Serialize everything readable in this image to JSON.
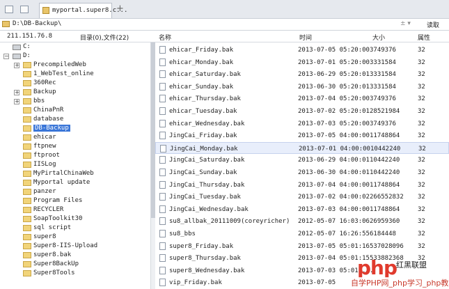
{
  "tabbar": {
    "tab_label": "myportal.super8.c...",
    "new_tab": "+"
  },
  "address": {
    "path": "D:\\DB-Backup\\",
    "arrows": "± ▾",
    "read_button": "读取"
  },
  "header": {
    "ip": "211.151.76.8",
    "summary": "目录(0),文件(22)",
    "col_name": "名称",
    "col_time": "时间",
    "col_size": "大小",
    "col_attr": "属性"
  },
  "tree": {
    "drive_c": "C:",
    "drive_d": "D:",
    "folders": [
      "PrecompiledWeb",
      "1_WebTest_online",
      "360Rec",
      "Backup",
      "bbs",
      "ChinaPnR",
      "database",
      "DB-Backup",
      "ehicar",
      "ftpnew",
      "ftproot",
      "IISLog",
      "MyPirtalChinaWeb",
      "Myportal update",
      "panzer",
      "Program Files",
      "RECYCLER",
      "SoapToolkit30",
      "sql script",
      "super8",
      "Super8-IIS-Upload",
      "super8.bak",
      "Super8BackUp",
      "Super8Tools"
    ]
  },
  "files": [
    {
      "name": "ehicar_Friday.bak",
      "time": "2013-07-05 05:20:00",
      "size": "3749376",
      "attr": "32"
    },
    {
      "name": "ehicar_Monday.bak",
      "time": "2013-07-01 05:20:00",
      "size": "3331584",
      "attr": "32"
    },
    {
      "name": "ehicar_Saturday.bak",
      "time": "2013-06-29 05:20:01",
      "size": "3331584",
      "attr": "32"
    },
    {
      "name": "ehicar_Sunday.bak",
      "time": "2013-06-30 05:20:01",
      "size": "3331584",
      "attr": "32"
    },
    {
      "name": "ehicar_Thursday.bak",
      "time": "2013-07-04 05:20:00",
      "size": "3749376",
      "attr": "32"
    },
    {
      "name": "ehicar_Tuesday.bak",
      "time": "2013-07-02 05:20:01",
      "size": "28521984",
      "attr": "32"
    },
    {
      "name": "ehicar_Wednesday.bak",
      "time": "2013-07-03 05:20:00",
      "size": "3749376",
      "attr": "32"
    },
    {
      "name": "JingCai_Friday.bak",
      "time": "2013-07-05 04:00:00",
      "size": "11748864",
      "attr": "32"
    },
    {
      "name": "JingCai_Monday.bak",
      "time": "2013-07-01 04:00:00",
      "size": "10442240",
      "attr": "32"
    },
    {
      "name": "JingCai_Saturday.bak",
      "time": "2013-06-29 04:00:01",
      "size": "10442240",
      "attr": "32"
    },
    {
      "name": "JingCai_Sunday.bak",
      "time": "2013-06-30 04:00:01",
      "size": "10442240",
      "attr": "32"
    },
    {
      "name": "JingCai_Thursday.bak",
      "time": "2013-07-04 04:00:00",
      "size": "11748864",
      "attr": "32"
    },
    {
      "name": "JingCai_Tuesday.bak",
      "time": "2013-07-02 04:00:02",
      "size": "266552832",
      "attr": "32"
    },
    {
      "name": "JingCai_Wednesday.bak",
      "time": "2013-07-03 04:00:00",
      "size": "11748864",
      "attr": "32"
    },
    {
      "name": "su8_allbak_20111009(coreyricher)",
      "time": "2012-05-07 16:03:06",
      "size": "26959360",
      "attr": "32"
    },
    {
      "name": "su8_bbs",
      "time": "2012-05-07 16:26:55",
      "size": "6184448",
      "attr": "32"
    },
    {
      "name": "super8_Friday.bak",
      "time": "2013-07-05 05:01:16",
      "size": "537028096",
      "attr": "32"
    },
    {
      "name": "super8_Thursday.bak",
      "time": "2013-07-04 05:01:15",
      "size": "533882368",
      "attr": "32"
    },
    {
      "name": "super8_Wednesday.bak",
      "time": "2013-07-03 05:01:...",
      "size": "",
      "attr": ""
    },
    {
      "name": "vip_Friday.bak",
      "time": "2013-07-05",
      "size": "",
      "attr": ""
    }
  ],
  "watermark": {
    "logo": "php",
    "cn": "红黑联盟",
    "bar": "自学PHP网_php学习_php教程"
  }
}
